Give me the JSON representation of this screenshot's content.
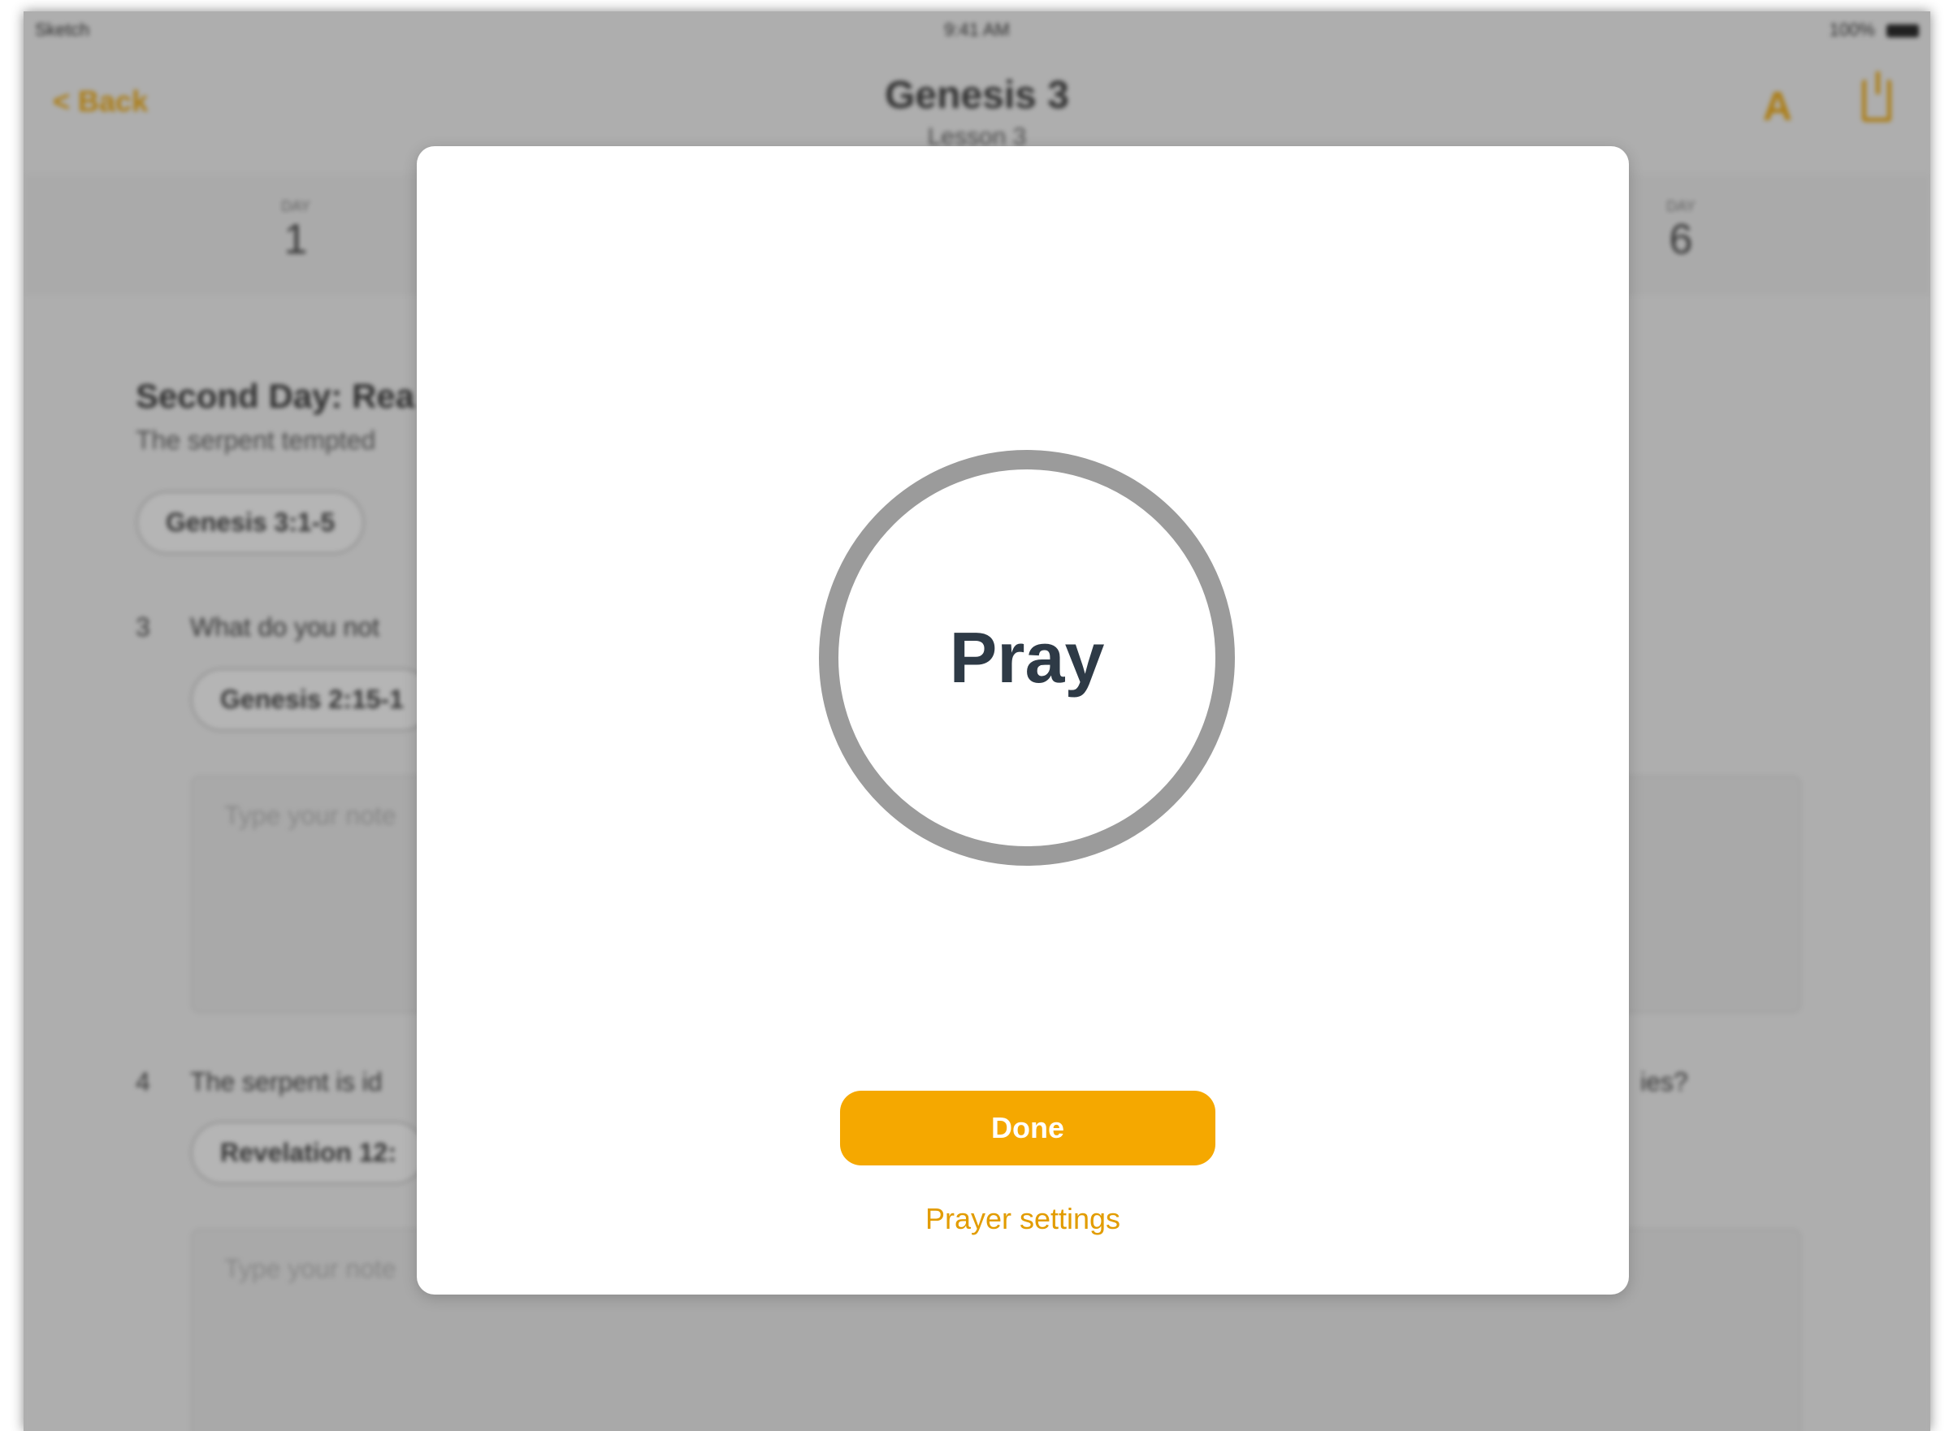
{
  "status_bar": {
    "carrier": "Sketch",
    "time": "9:41 AM",
    "battery": "100%"
  },
  "navbar": {
    "back_label": "< Back",
    "title": "Genesis 3",
    "subtitle": "Lesson 3"
  },
  "day_strip": {
    "day_label": "DAY",
    "days": [
      "1",
      "6"
    ]
  },
  "content": {
    "section_title": "Second Day: Rea",
    "section_sub": "The serpent tempted",
    "ref_1": "Genesis 3:1-5",
    "q3_num": "3",
    "q3_text": "What do you not",
    "ref_2": "Genesis 2:15-1",
    "answer_placeholder": "Type your note",
    "q4_num": "4",
    "q4_text": "The serpent is id",
    "q4_tail": "ies?",
    "ref_3": "Revelation 12:"
  },
  "modal": {
    "circle_label": "Pray",
    "done_label": "Done",
    "settings_label": "Prayer settings"
  },
  "colors": {
    "accent": "#f5a800",
    "accent_text": "#e29c00",
    "circle_ring": "#9b9b9b",
    "circle_text": "#2e3a46"
  }
}
